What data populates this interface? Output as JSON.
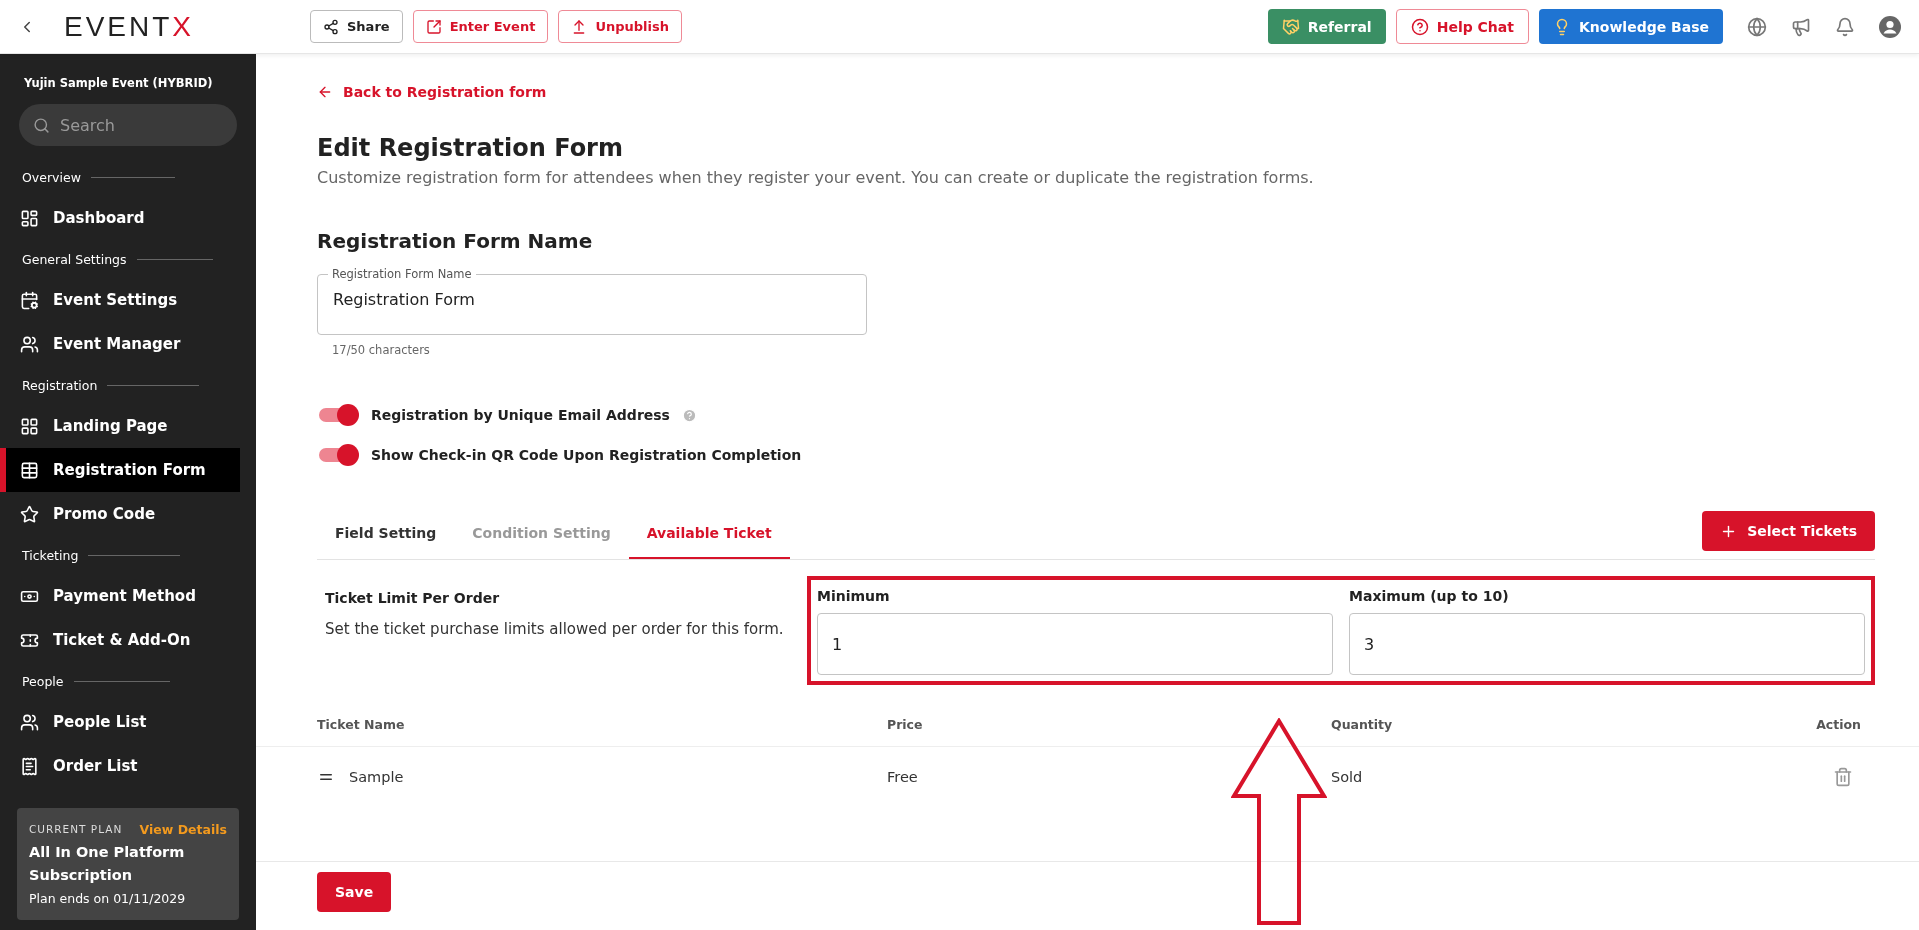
{
  "topbar": {
    "logo": {
      "main": "EVENT",
      "accent": "X"
    },
    "actions": [
      {
        "label": "Share",
        "kind": "neutral"
      },
      {
        "label": "Enter Event",
        "kind": "danger"
      },
      {
        "label": "Unpublish",
        "kind": "danger"
      }
    ],
    "links": [
      {
        "label": "Referral",
        "kind": "green"
      },
      {
        "label": "Help Chat",
        "kind": "outline"
      },
      {
        "label": "Knowledge Base",
        "kind": "blue"
      }
    ]
  },
  "sidebar": {
    "event_title": "Yujin Sample Event (HYBRID)",
    "search": {
      "placeholder": "Search"
    },
    "sections": [
      {
        "label": "Overview",
        "items": [
          {
            "label": "Dashboard",
            "selected": false
          }
        ]
      },
      {
        "label": "General Settings",
        "items": [
          {
            "label": "Event Settings",
            "selected": false
          },
          {
            "label": "Event Manager",
            "selected": false
          }
        ]
      },
      {
        "label": "Registration",
        "items": [
          {
            "label": "Landing Page",
            "selected": false
          },
          {
            "label": "Registration Form",
            "selected": true
          },
          {
            "label": "Promo Code",
            "selected": false
          }
        ]
      },
      {
        "label": "Ticketing",
        "items": [
          {
            "label": "Payment Method",
            "selected": false
          },
          {
            "label": "Ticket & Add-On",
            "selected": false
          }
        ]
      },
      {
        "label": "People",
        "items": [
          {
            "label": "People List",
            "selected": false
          },
          {
            "label": "Order List",
            "selected": false
          }
        ]
      }
    ],
    "plan": {
      "caption": "CURRENT PLAN",
      "link": "View Details",
      "name": "All In One Platform Subscription",
      "ends": "Plan ends on 01/11/2029"
    }
  },
  "main": {
    "back": "Back to Registration form",
    "title": "Edit Registration Form",
    "description": "Customize registration form for attendees when they register your event. You can create or duplicate the registration forms.",
    "name_section": {
      "heading": "Registration Form Name",
      "field_label": "Registration Form Name",
      "value": "Registration Form",
      "counter": "17/50 characters"
    },
    "toggles": [
      {
        "label": "Registration by Unique Email Address",
        "on": true,
        "help": true
      },
      {
        "label": "Show Check-in QR Code Upon Registration Completion",
        "on": true,
        "help": false
      }
    ],
    "tabs": [
      {
        "label": "Field Setting",
        "selected": false,
        "disabled": false
      },
      {
        "label": "Condition Setting",
        "selected": false,
        "disabled": true
      },
      {
        "label": "Available Ticket",
        "selected": true,
        "disabled": false
      }
    ],
    "select_button": "Select Tickets",
    "limit": {
      "title": "Ticket Limit Per Order",
      "text": "Set the ticket purchase limits allowed per order for this form.",
      "fields": [
        {
          "label": "Minimum",
          "value": "1"
        },
        {
          "label": "Maximum (up to 10)",
          "value": "3"
        }
      ]
    },
    "table": {
      "columns": [
        "Ticket Name",
        "Price",
        "Quantity",
        "Action"
      ],
      "rows": [
        {
          "name": "Sample",
          "price": "Free",
          "quantity": "Sold"
        }
      ]
    },
    "save": "Save"
  },
  "annotations": {
    "highlight_box": true,
    "up_arrow": true
  }
}
